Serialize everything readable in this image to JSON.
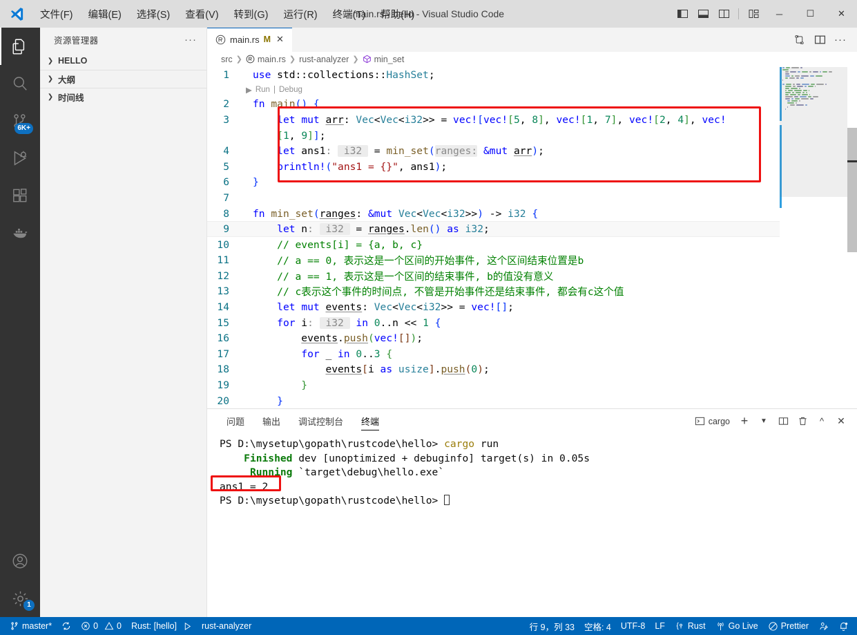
{
  "titlebar": {
    "window_title": "main.rs - hello - Visual Studio Code",
    "menus": [
      {
        "label": "文件(F)"
      },
      {
        "label": "编辑(E)"
      },
      {
        "label": "选择(S)"
      },
      {
        "label": "查看(V)"
      },
      {
        "label": "转到(G)"
      },
      {
        "label": "运行(R)"
      },
      {
        "label": "终端(T)"
      },
      {
        "label": "帮助(H)"
      }
    ],
    "layout_controls": [
      "toggle-primary-sidebar",
      "toggle-panel",
      "toggle-secondary-sidebar",
      "customize-layout"
    ],
    "window_controls": {
      "minimize": "─",
      "maximize": "☐",
      "close": "✕"
    }
  },
  "activitybar": {
    "items": [
      {
        "name": "explorer",
        "active": true,
        "badge": ""
      },
      {
        "name": "search",
        "active": false,
        "badge": ""
      },
      {
        "name": "source-control",
        "active": false,
        "badge": "6K+"
      },
      {
        "name": "run-and-debug",
        "active": false,
        "badge": ""
      },
      {
        "name": "extensions",
        "active": false,
        "badge": ""
      },
      {
        "name": "docker",
        "active": false,
        "badge": ""
      }
    ],
    "bottom": [
      {
        "name": "accounts",
        "badge": ""
      },
      {
        "name": "settings",
        "badge": "1"
      }
    ]
  },
  "sidebar": {
    "title": "资源管理器",
    "more_actions": "···",
    "sections": [
      {
        "label": "HELLO",
        "expanded": false
      },
      {
        "label": "大纲",
        "expanded": false
      },
      {
        "label": "时间线",
        "expanded": false
      }
    ]
  },
  "editor": {
    "tab": {
      "filename": "main.rs",
      "modified_badge": "M",
      "close": "✕"
    },
    "actions": [
      "open-changes-icon",
      "split-editor-icon",
      "more-actions-icon"
    ],
    "breadcrumbs": [
      {
        "label": "src",
        "icon": ""
      },
      {
        "label": "main.rs",
        "icon": "rust-file-icon"
      },
      {
        "label": "rust-analyzer",
        "icon": ""
      },
      {
        "label": "min_set",
        "icon": "symbol-method-icon"
      }
    ],
    "codelens": {
      "run": "Run",
      "divider": "|",
      "debug": "Debug"
    },
    "current_line": 9,
    "lines": [
      {
        "num": "1",
        "html": "<span class=\"kw\">use</span> std<span class=\"op\">::</span>collections<span class=\"op\">::</span><span class=\"typ\">HashSet</span>;"
      },
      {
        "num": "2",
        "html": "<span class=\"kw\">fn</span> <span class=\"fn\">main</span><span class=\"brk1\">()</span> <span class=\"brk1\">{</span>"
      },
      {
        "num": "3",
        "html": "    <span class=\"kw\">let</span> <span class=\"kw\">mut</span> <span class=\"u\">arr</span>: <span class=\"typ\">Vec</span>&lt;<span class=\"typ\">Vec</span>&lt;<span class=\"typ\">i32</span>&gt;&gt; <span class=\"op\">=</span> <span class=\"mac\">vec!</span><span class=\"brk1\">[</span><span class=\"mac\">vec!</span><span class=\"brk2\">[</span><span class=\"num\">5</span>, <span class=\"num\">8</span><span class=\"brk2\">]</span>, <span class=\"mac\">vec!</span><span class=\"brk2\">[</span><span class=\"num\">1</span>, <span class=\"num\">7</span><span class=\"brk2\">]</span>, <span class=\"mac\">vec!</span><span class=\"brk2\">[</span><span class=\"num\">2</span>, <span class=\"num\">4</span><span class=\"brk2\">]</span>, <span class=\"mac\">vec!</span>"
      },
      {
        "num": "",
        "html": "    <span class=\"brk2\">[</span><span class=\"num\">1</span>, <span class=\"num\">9</span><span class=\"brk2\">]</span><span class=\"brk1\">]</span>;"
      },
      {
        "num": "4",
        "html": "    <span class=\"kw\">let</span> ans1<span class=\"hintp\">:</span> <span class=\"hint\">&nbsp;i32&nbsp;</span> <span class=\"op\">=</span> <span class=\"fn\">min_set</span><span class=\"brk1\">(</span><span class=\"hint\">ranges:</span> <span class=\"kw\">&amp;mut</span> <span class=\"u\">arr</span><span class=\"brk1\">)</span>;"
      },
      {
        "num": "5",
        "html": "    <span class=\"mac\">println!</span><span class=\"brk1\">(</span><span class=\"str\">\"ans1 = {}\"</span>, ans1<span class=\"brk1\">)</span>;"
      },
      {
        "num": "6",
        "html": "<span class=\"brk1\">}</span>"
      },
      {
        "num": "7",
        "html": ""
      },
      {
        "num": "8",
        "html": "<span class=\"kw\">fn</span> <span class=\"fn\">min_set</span><span class=\"brk1\">(</span><span class=\"u\">ranges</span>: <span class=\"kw\">&amp;mut</span> <span class=\"typ\">Vec</span>&lt;<span class=\"typ\">Vec</span>&lt;<span class=\"typ\">i32</span>&gt;&gt;<span class=\"brk1\">)</span> <span class=\"op\">-&gt;</span> <span class=\"typ\">i32</span> <span class=\"brk1\">{</span>"
      },
      {
        "num": "9",
        "html": "    <span class=\"kw\">let</span> n<span class=\"hintp\">:</span> <span class=\"hint\">&nbsp;i32&nbsp;</span> <span class=\"op\">=</span> <span class=\"u\">ranges</span>.<span class=\"fn\">len</span><span class=\"brk1\">()</span> <span class=\"kw\">as</span> <span class=\"typ\">i32</span>;"
      },
      {
        "num": "10",
        "html": "    <span class=\"cmt\">// events[i] = {a, b, c}</span>"
      },
      {
        "num": "11",
        "html": "    <span class=\"cmt\">// a == 0, 表示这是一个区间的开始事件, 这个区间结束位置是b</span>"
      },
      {
        "num": "12",
        "html": "    <span class=\"cmt\">// a == 1, 表示这是一个区间的结束事件, b的值没有意义</span>"
      },
      {
        "num": "13",
        "html": "    <span class=\"cmt\">// c表示这个事件的时间点, 不管是开始事件还是结束事件, 都会有c这个值</span>"
      },
      {
        "num": "14",
        "html": "    <span class=\"kw\">let</span> <span class=\"kw\">mut</span> <span class=\"u\">events</span>: <span class=\"typ\">Vec</span>&lt;<span class=\"typ\">Vec</span>&lt;<span class=\"typ\">i32</span>&gt;&gt; <span class=\"op\">=</span> <span class=\"mac\">vec!</span><span class=\"brk1\">[]</span>;"
      },
      {
        "num": "15",
        "html": "    <span class=\"kw\">for</span> i<span class=\"hintp\">:</span> <span class=\"hint\">&nbsp;i32&nbsp;</span> <span class=\"kw\">in</span> <span class=\"num\">0</span>..n <span class=\"op\">&lt;&lt;</span> <span class=\"num\">1</span> <span class=\"brk1\">{</span>"
      },
      {
        "num": "16",
        "html": "        <span class=\"u\">events</span>.<span class=\"u fn\">push</span><span class=\"brk2\">(</span><span class=\"mac\">vec!</span><span class=\"brk3\">[]</span><span class=\"brk2\">)</span>;"
      },
      {
        "num": "17",
        "html": "        <span class=\"kw\">for</span> _ <span class=\"kw\">in</span> <span class=\"num\">0</span>..<span class=\"num\">3</span> <span class=\"brk2\">{</span>"
      },
      {
        "num": "18",
        "html": "            <span class=\"u\">events</span><span class=\"brk3\">[</span>i <span class=\"kw\">as</span> <span class=\"typ\">usize</span><span class=\"brk3\">]</span>.<span class=\"u fn\">push</span><span class=\"brk3\">(</span><span class=\"num\">0</span><span class=\"brk3\">)</span>;"
      },
      {
        "num": "19",
        "html": "        <span class=\"brk2\">}</span>"
      },
      {
        "num": "20",
        "html": "    <span class=\"brk1\">}</span>"
      }
    ]
  },
  "panel": {
    "tabs": [
      {
        "label": "问题",
        "active": false
      },
      {
        "label": "输出",
        "active": false
      },
      {
        "label": "调试控制台",
        "active": false
      },
      {
        "label": "终端",
        "active": true
      }
    ],
    "terminal_name": "cargo",
    "actions": [
      "new-terminal-icon",
      "terminal-dropdown-icon",
      "split-terminal-icon",
      "kill-terminal-icon",
      "maximize-panel-icon",
      "close-panel-icon"
    ],
    "terminal_lines": [
      {
        "segments": [
          {
            "t": "PS D:\\mysetup\\gopath\\rustcode\\hello> ",
            "c": ""
          },
          {
            "t": "cargo",
            "c": "t-yellow"
          },
          {
            "t": " run",
            "c": ""
          }
        ]
      },
      {
        "segments": [
          {
            "t": "    ",
            "c": ""
          },
          {
            "t": "Finished",
            "c": "t-green"
          },
          {
            "t": " dev [unoptimized + debuginfo] target(s) in 0.05s",
            "c": ""
          }
        ]
      },
      {
        "segments": [
          {
            "t": "     ",
            "c": ""
          },
          {
            "t": "Running",
            "c": "t-green"
          },
          {
            "t": " `target\\debug\\hello.exe`",
            "c": ""
          }
        ]
      },
      {
        "segments": [
          {
            "t": "ans1 = 2",
            "c": ""
          }
        ]
      },
      {
        "segments": [
          {
            "t": "PS D:\\mysetup\\gopath\\rustcode\\hello> ",
            "c": ""
          }
        ]
      }
    ]
  },
  "statusbar": {
    "left": [
      {
        "name": "branch",
        "icon": "source-control-icon",
        "label": "master*"
      },
      {
        "name": "sync",
        "icon": "sync-icon",
        "label": ""
      },
      {
        "name": "problems",
        "icon": "error-warning-icons",
        "label": "0  0",
        "errors": "0",
        "warnings": "0"
      },
      {
        "name": "rust-project",
        "icon": "",
        "label": "Rust: [hello]"
      },
      {
        "name": "rust-run",
        "icon": "play-icon",
        "label": ""
      },
      {
        "name": "rust-analyzer",
        "icon": "",
        "label": "rust-analyzer"
      }
    ],
    "right": [
      {
        "name": "cursor-position",
        "label": "行 9，列 33"
      },
      {
        "name": "indentation",
        "label": "空格: 4"
      },
      {
        "name": "encoding",
        "label": "UTF-8"
      },
      {
        "name": "eol",
        "label": "LF"
      },
      {
        "name": "language-mode",
        "icon": "brackets-icon",
        "label": "Rust"
      },
      {
        "name": "go-live",
        "icon": "broadcast-icon",
        "label": "Go Live"
      },
      {
        "name": "prettier",
        "icon": "prettier-icon",
        "label": "Prettier"
      },
      {
        "name": "remote-feedback",
        "icon": "feedback-icon",
        "label": ""
      },
      {
        "name": "notifications",
        "icon": "bell-dot-icon",
        "label": ""
      }
    ]
  },
  "annotations": {
    "code_highlight_color": "#ee1111",
    "terminal_highlight_color": "#ee1111"
  }
}
